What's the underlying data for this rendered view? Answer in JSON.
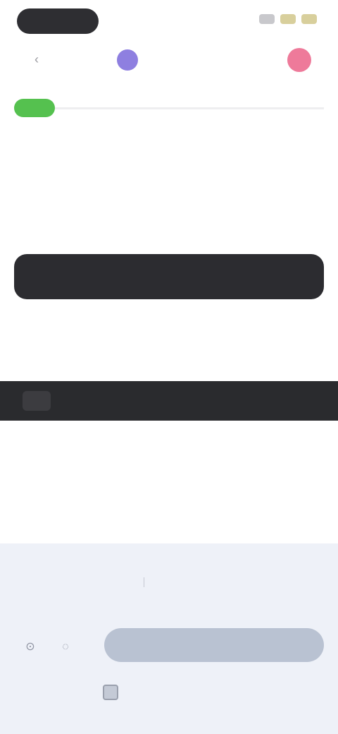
{
  "status": {
    "pill": "",
    "icons": [
      "signal-icon",
      "wifi-icon",
      "battery-icon"
    ]
  },
  "toolbar": {
    "back_icon": "‹",
    "account_label": "",
    "mid_label": "",
    "avatar_color": "#ee7a9a"
  },
  "progress": {
    "accent": "#55c14f"
  },
  "heading": "",
  "description": "",
  "code_field": {
    "segment1": "",
    "segment2": ""
  },
  "hint": "",
  "banner": {
    "icon_label": "",
    "text": ""
  },
  "bottom": {
    "tabs": [
      {
        "label": ""
      },
      {
        "label": ""
      }
    ],
    "actions": [
      "⊙",
      "◌"
    ],
    "pay_button": "",
    "agree_text": ""
  },
  "colors": {
    "dark": "#2c2c30",
    "panel": "#eef1f8",
    "button": "#b9c2d2"
  }
}
